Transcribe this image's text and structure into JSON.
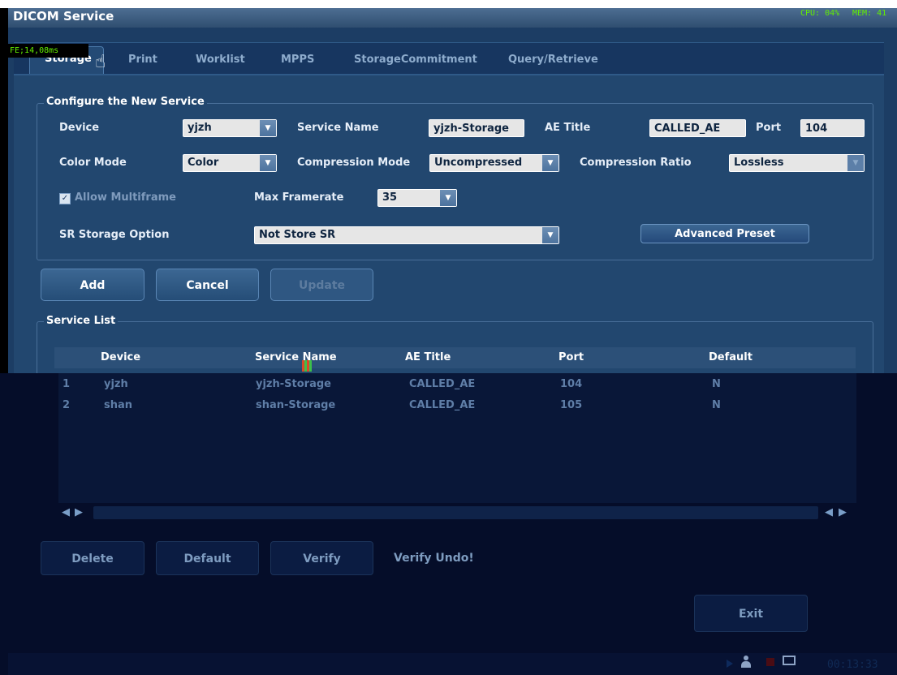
{
  "window": {
    "title": "DICOM Service",
    "cpu": "CPU: 04%",
    "mem": "MEM: 41"
  },
  "fe_overlay": "FE;14,08ms",
  "tabs": [
    {
      "label": "Storage",
      "active": true
    },
    {
      "label": "Print"
    },
    {
      "label": "Worklist"
    },
    {
      "label": "MPPS"
    },
    {
      "label": "StorageCommitment"
    },
    {
      "label": "Query/Retrieve"
    }
  ],
  "config": {
    "group_title": "Configure the New Service",
    "device_label": "Device",
    "device_value": "yjzh",
    "service_name_label": "Service Name",
    "service_name_value": "yjzh-Storage",
    "ae_title_label": "AE Title",
    "ae_title_value": "CALLED_AE",
    "port_label": "Port",
    "port_value": "104",
    "color_mode_label": "Color Mode",
    "color_mode_value": "Color",
    "compression_mode_label": "Compression Mode",
    "compression_mode_value": "Uncompressed",
    "compression_ratio_label": "Compression Ratio",
    "compression_ratio_value": "Lossless",
    "allow_multiframe_label": "Allow Multiframe",
    "allow_multiframe_checked": true,
    "max_framerate_label": "Max Framerate",
    "max_framerate_value": "35",
    "sr_storage_label": "SR Storage Option",
    "sr_storage_value": "Not Store SR",
    "advanced_preset_label": "Advanced Preset"
  },
  "actions": {
    "add": "Add",
    "cancel": "Cancel",
    "update": "Update"
  },
  "service_list": {
    "group_title": "Service List",
    "columns": [
      "Device",
      "Service Name",
      "AE Title",
      "Port",
      "Default"
    ],
    "rows": [
      {
        "index": "1",
        "device": "yjzh",
        "service_name": "yjzh-Storage",
        "ae_title": "CALLED_AE",
        "port": "104",
        "default": "N"
      },
      {
        "index": "2",
        "device": "shan",
        "service_name": "shan-Storage",
        "ae_title": "CALLED_AE",
        "port": "105",
        "default": "N"
      }
    ]
  },
  "list_actions": {
    "delete": "Delete",
    "default": "Default",
    "verify": "Verify",
    "verify_status": "Verify Undo!"
  },
  "exit_label": "Exit",
  "clock": "00:13:33"
}
